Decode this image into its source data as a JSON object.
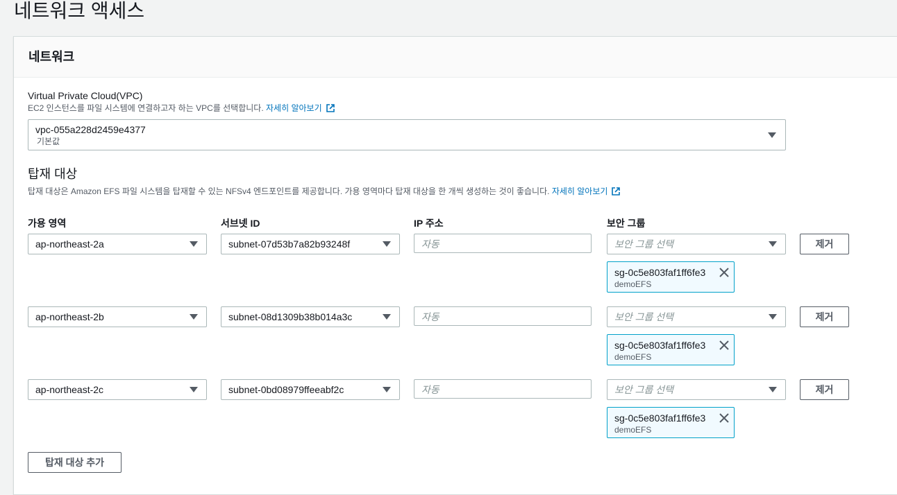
{
  "page": {
    "title": "네트워크 액세스"
  },
  "network": {
    "heading": "네트워크",
    "vpc": {
      "label": "Virtual Private Cloud(VPC)",
      "description": "EC2 인스턴스를 파일 시스템에 연결하고자 하는 VPC를 선택합니다.",
      "learn_more": "자세히 알아보기",
      "value": "vpc-055a228d2459e4377",
      "sub": "기본값"
    },
    "mount_targets": {
      "title": "탑재 대상",
      "description": "탑재 대상은 Amazon EFS 파일 시스템을 탑재할 수 있는 NFSv4 엔드포인트를 제공합니다. 가용 영역마다 탑재 대상을 한 개씩 생성하는 것이 좋습니다.",
      "learn_more": "자세히 알아보기",
      "columns": {
        "az": "가용 영역",
        "subnet": "서브넷 ID",
        "ip": "IP 주소",
        "sg": "보안 그룹"
      },
      "ip_placeholder": "자동",
      "sg_placeholder": "보안 그룹 선택",
      "remove_label": "제거",
      "add_label": "탑재 대상 추가",
      "rows": [
        {
          "az": "ap-northeast-2a",
          "subnet": "subnet-07d53b7a82b93248f",
          "sg_id": "sg-0c5e803faf1ff6fe3",
          "sg_name": "demoEFS"
        },
        {
          "az": "ap-northeast-2b",
          "subnet": "subnet-08d1309b38b014a3c",
          "sg_id": "sg-0c5e803faf1ff6fe3",
          "sg_name": "demoEFS"
        },
        {
          "az": "ap-northeast-2c",
          "subnet": "subnet-0bd08979ffeeabf2c",
          "sg_id": "sg-0c5e803faf1ff6fe3",
          "sg_name": "demoEFS"
        }
      ]
    }
  },
  "colors": {
    "link": "#0073bb",
    "token_border": "#00a1c9",
    "token_bg": "#f1faff"
  }
}
